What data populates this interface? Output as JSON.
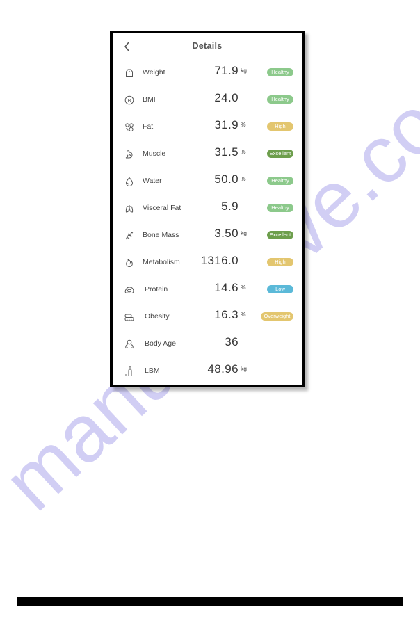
{
  "header": {
    "back_icon": "chevron-left-icon",
    "title": "Details"
  },
  "colors": {
    "healthy": "#8cc98b",
    "high": "#e3c66f",
    "excellent": "#6d9e4c",
    "low": "#5bb9d8",
    "overweight": "#e3c66f",
    "watermark": "#c9c6f2"
  },
  "metrics": [
    {
      "icon": "weight-scale-icon",
      "label": "Weight",
      "value": "71.9",
      "unit": "kg",
      "status": "Healthy",
      "status_color": "#8cc98b"
    },
    {
      "icon": "bmi-icon",
      "label": "BMI",
      "value": "24.0",
      "unit": "",
      "status": "Healthy",
      "status_color": "#8cc98b"
    },
    {
      "icon": "fat-icon",
      "label": "Fat",
      "value": "31.9",
      "unit": "%",
      "status": "High",
      "status_color": "#e3c66f"
    },
    {
      "icon": "muscle-icon",
      "label": "Muscle",
      "value": "31.5",
      "unit": "%",
      "status": "Excellent",
      "status_color": "#6d9e4c"
    },
    {
      "icon": "water-drop-icon",
      "label": "Water",
      "value": "50.0",
      "unit": "%",
      "status": "Healthy",
      "status_color": "#8cc98b"
    },
    {
      "icon": "visceral-fat-icon",
      "label": "Visceral Fat",
      "value": "5.9",
      "unit": "",
      "status": "Healthy",
      "status_color": "#8cc98b"
    },
    {
      "icon": "bone-icon",
      "label": "Bone Mass",
      "value": "3.50",
      "unit": "kg",
      "status": "Excellent",
      "status_color": "#6d9e4c"
    },
    {
      "icon": "metabolism-flame-icon",
      "label": "Metabolism",
      "value": "1316.0",
      "unit": "",
      "status": "High",
      "status_color": "#e3c66f"
    },
    {
      "icon": "protein-egg-icon",
      "label": "Protein",
      "value": "14.6",
      "unit": "%",
      "status": "Low",
      "status_color": "#5bb9d8"
    },
    {
      "icon": "obesity-icon",
      "label": "Obesity",
      "value": "16.3",
      "unit": "%",
      "status": "Overweight",
      "status_color": "#e3c66f"
    },
    {
      "icon": "body-age-person-icon",
      "label": "Body Age",
      "value": "36",
      "unit": "",
      "status": "",
      "status_color": ""
    },
    {
      "icon": "lbm-person-icon",
      "label": "LBM",
      "value": "48.96",
      "unit": "kg",
      "status": "",
      "status_color": ""
    }
  ],
  "watermark": {
    "text": "manualshive.com"
  }
}
